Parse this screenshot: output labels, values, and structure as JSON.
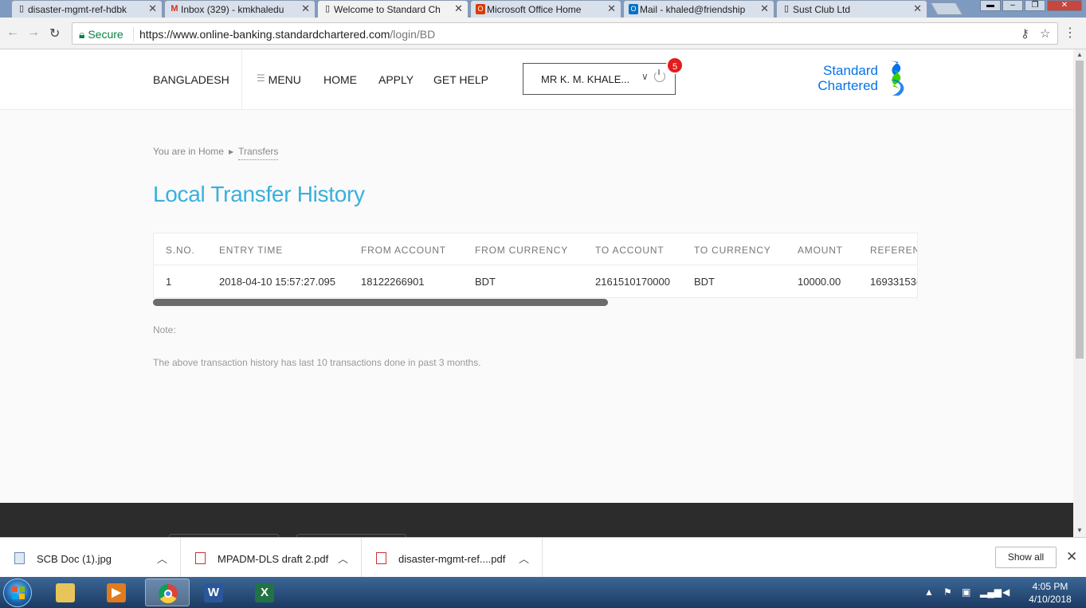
{
  "browser": {
    "tabs": [
      {
        "title": "disaster-mgmt-ref-hdbk",
        "icon": "document-icon",
        "active": false
      },
      {
        "title": "Inbox (329) - kmkhaledu",
        "icon": "gmail-icon",
        "active": false
      },
      {
        "title": "Welcome to Standard Ch",
        "icon": "document-icon",
        "active": true
      },
      {
        "title": "Microsoft Office Home",
        "icon": "office-icon",
        "active": false
      },
      {
        "title": "Mail - khaled@friendship",
        "icon": "outlook-icon",
        "active": false
      },
      {
        "title": "Sust Club Ltd",
        "icon": "document-icon",
        "active": false
      }
    ],
    "secure_label": "Secure",
    "url_host": "https://www.online-banking.standardchartered.com",
    "url_path": "/login/BD"
  },
  "header": {
    "country": "BANGLADESH",
    "menu": "MENU",
    "home": "HOME",
    "apply": "APPLY",
    "get_help": "GET HELP",
    "user_name": "MR  K. M. KHALE...",
    "notification_count": "5",
    "logo_line1": "Standard",
    "logo_line2": "Chartered",
    "brand_colors": {
      "blue": "#0473ea",
      "green": "#38d200"
    }
  },
  "breadcrumb": {
    "prefix": "You are in",
    "home": "Home",
    "current": "Transfers"
  },
  "page_title": "Local Transfer History",
  "table": {
    "headers": [
      "S.NO.",
      "ENTRY TIME",
      "FROM ACCOUNT",
      "FROM CURRENCY",
      "TO ACCOUNT",
      "TO CURRENCY",
      "AMOUNT",
      "REFEREN"
    ],
    "rows": [
      [
        "1",
        "2018-04-10 15:57:27.095",
        "18122266901",
        "BDT",
        "2161510170000",
        "BDT",
        "10000.00",
        "16933153("
      ]
    ]
  },
  "note": {
    "label": "Note:",
    "text": "The above transaction history has last 10 transactions done in past 3 months."
  },
  "downloads": {
    "items": [
      {
        "name": "SCB Doc (1).jpg",
        "icon": "image-file-icon"
      },
      {
        "name": "MPADM-DLS draft 2.pdf",
        "icon": "pdf-file-icon"
      },
      {
        "name": "disaster-mgmt-ref....pdf",
        "icon": "pdf-file-icon"
      }
    ],
    "show_all": "Show all"
  },
  "taskbar": {
    "time": "4:05 PM",
    "date": "4/10/2018"
  }
}
